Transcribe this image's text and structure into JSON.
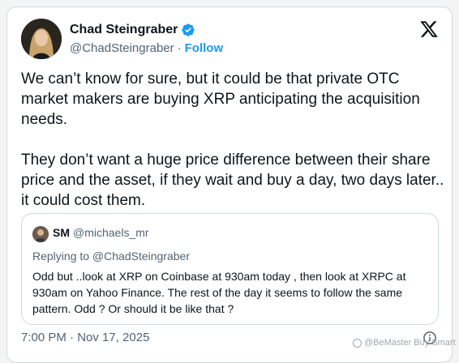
{
  "author": {
    "name": "Chad Steingraber",
    "handle": "@ChadSteingraber",
    "separator": "·",
    "follow_label": "Follow",
    "verified_icon": "verified-badge-icon"
  },
  "brand": {
    "logo_icon": "x-logo-icon"
  },
  "tweet": {
    "text": "We can’t know for sure, but it could be that private OTC market makers are buying XRP anticipating the acquisition needs.\n\nThey don’t want a huge price difference between their share price and the asset, if they wait and buy a day, two days later.. it could cost them."
  },
  "quote": {
    "name": "SM",
    "handle": "@michaels_mr",
    "replying_to": "Replying to @ChadSteingraber",
    "text": "Odd but ..look at XRP on Coinbase at 930am today , then look at XRPC at 930am on Yahoo Finance. The rest of the day it seems to follow the same pattern. Odd ? Or should it be like that ?"
  },
  "footer": {
    "timestamp": "7:00 PM · Nov 17, 2025",
    "info_icon": "info-icon"
  },
  "watermark": {
    "text": "@BeMaster Buy Smart"
  },
  "colors": {
    "link_blue": "#1d9bf0",
    "text_primary": "#0f1419",
    "text_secondary": "#536471",
    "border": "#cfd9de"
  }
}
